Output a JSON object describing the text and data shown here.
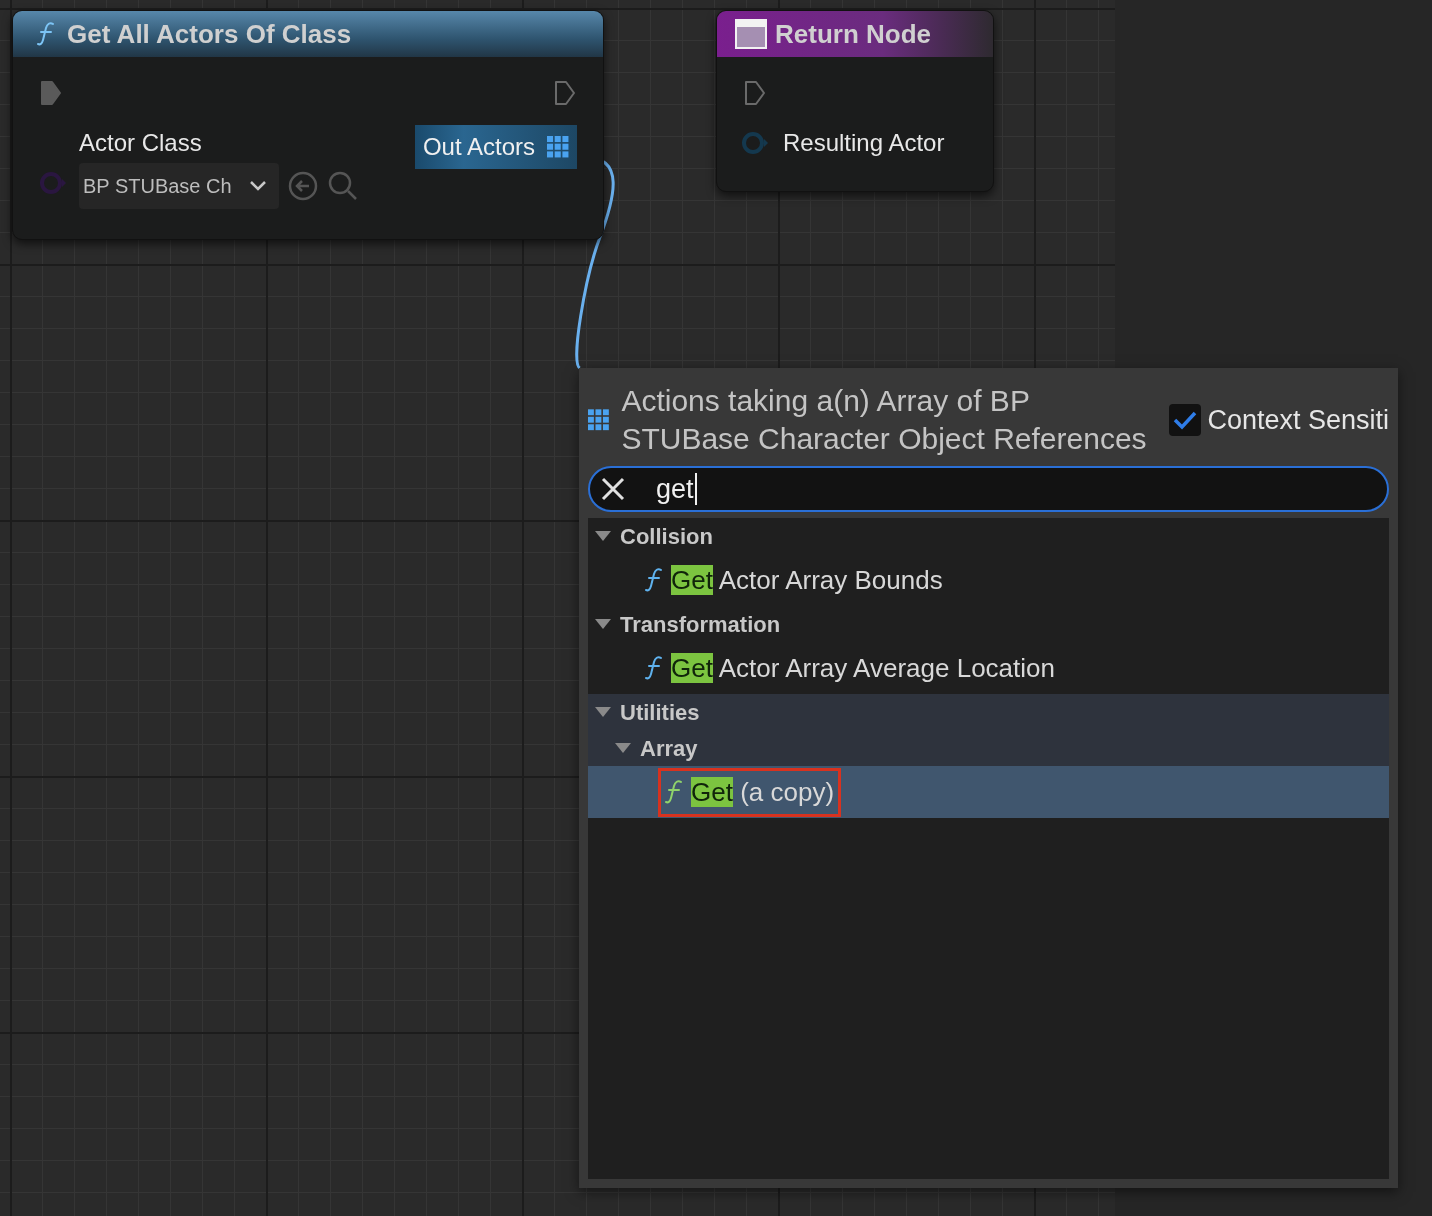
{
  "function_node": {
    "title": "Get All Actors Of Class",
    "input_pin": {
      "label": "Actor Class",
      "value": "BP STUBase Ch"
    },
    "output_pin": {
      "label": "Out Actors",
      "highlighted": true
    }
  },
  "return_node": {
    "title": "Return Node",
    "pin": {
      "label": "Resulting Actor"
    }
  },
  "action_menu": {
    "title": "Actions taking a(n) Array of BP STUBase Character Object References",
    "context_sensitive": {
      "label": "Context Sensiti",
      "checked": true
    },
    "search": {
      "value": "get"
    },
    "tree": [
      {
        "kind": "category",
        "label": "Collision",
        "expanded": true,
        "children": [
          {
            "kind": "action",
            "match": "Get",
            "text": " Actor Array Bounds",
            "selected": false,
            "outlined": false
          }
        ]
      },
      {
        "kind": "category",
        "label": "Transformation",
        "expanded": true,
        "children": [
          {
            "kind": "action",
            "match": "Get",
            "text": " Actor Array Average Location",
            "selected": false,
            "outlined": false
          }
        ]
      },
      {
        "kind": "category",
        "label": "Utilities",
        "expanded": true,
        "children": [
          {
            "kind": "category",
            "label": "Array",
            "expanded": true,
            "children": [
              {
                "kind": "action",
                "match": "Get",
                "text": " (a copy)",
                "selected": true,
                "outlined": true
              }
            ]
          }
        ]
      }
    ]
  }
}
